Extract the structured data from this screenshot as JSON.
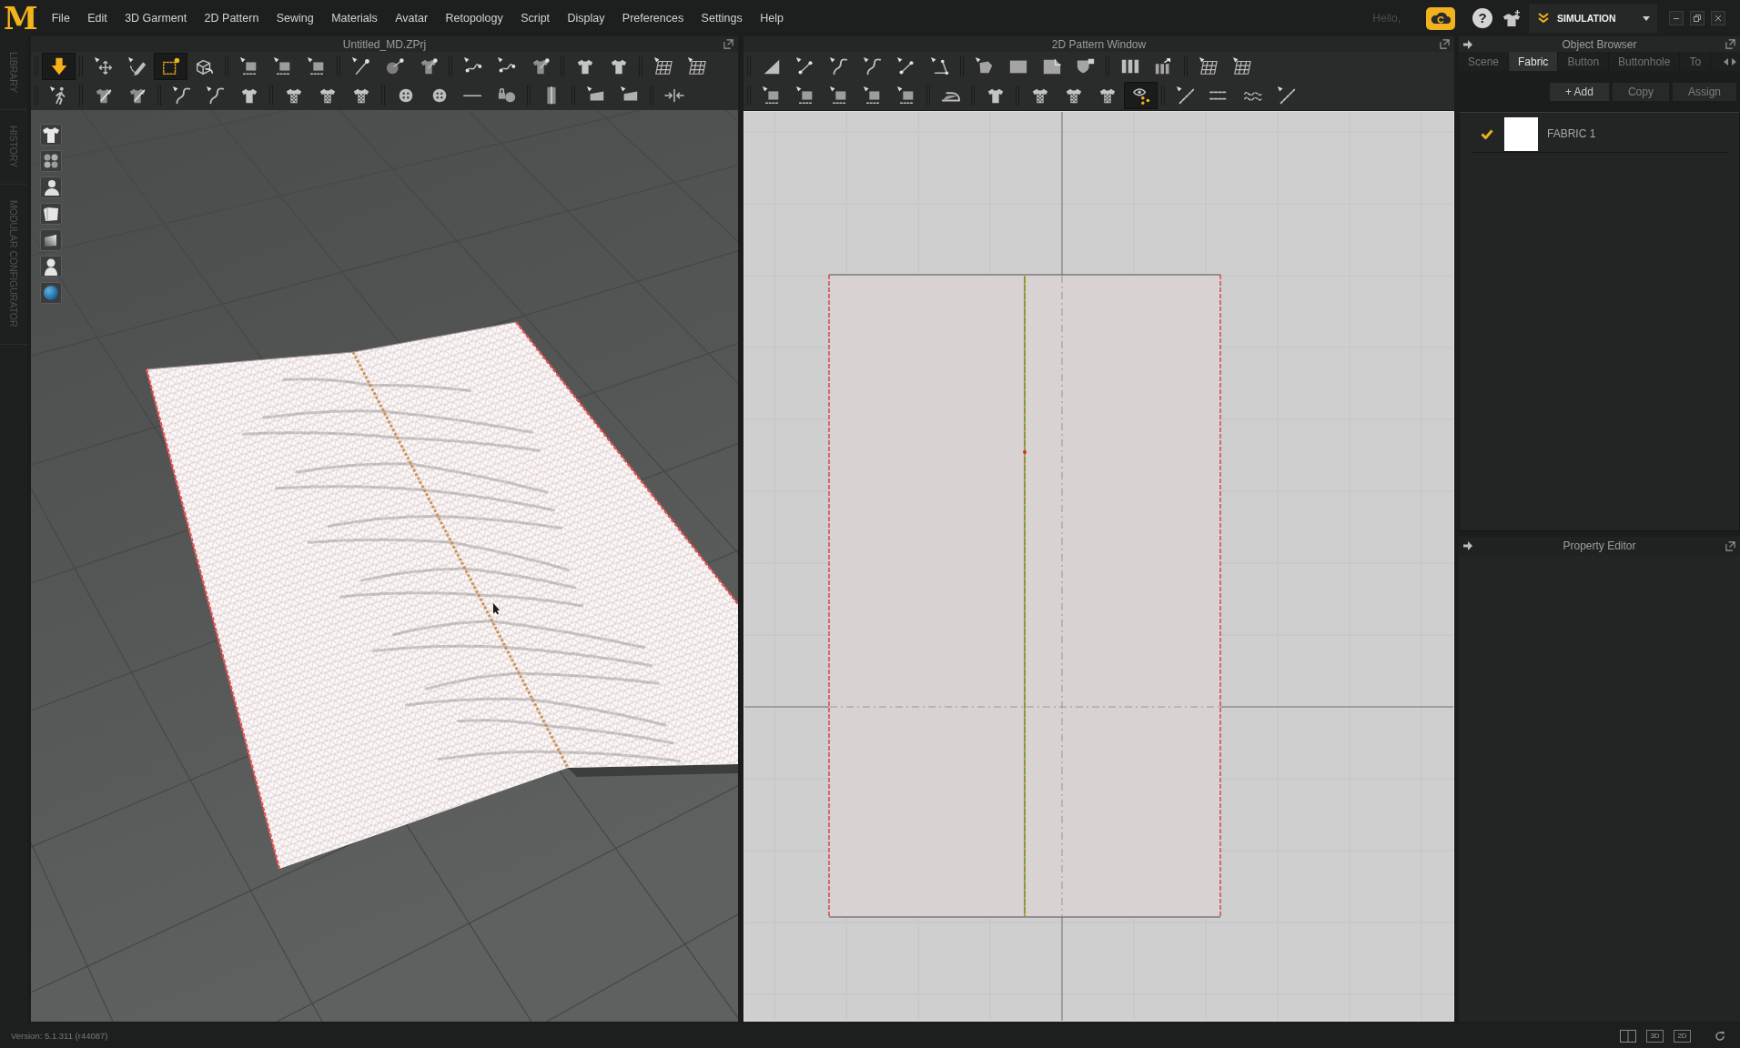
{
  "menu_bar": {
    "logo": "M",
    "menus": [
      "File",
      "Edit",
      "3D Garment",
      "2D Pattern",
      "Sewing",
      "Materials",
      "Avatar",
      "Retopology",
      "Script",
      "Display",
      "Preferences",
      "Settings",
      "Help"
    ],
    "greeting": "Hello,",
    "help": "?",
    "mode": "SIMULATION"
  },
  "side_tabs": [
    "LIBRARY",
    "HISTORY",
    "MODULAR CONFIGURATOR"
  ],
  "viewport_3d": {
    "title": "Untitled_MD.ZPrj",
    "toolbar_rows": [
      [
        [
          {
            "selected": true
          }
        ],
        [
          {
            "selected": false
          },
          {
            "selected": false
          },
          {
            "selected": true
          },
          {
            "selected": false
          }
        ],
        [
          {
            "selected": false
          },
          {
            "selected": false
          },
          {
            "selected": false
          }
        ],
        [
          {
            "selected": false
          },
          {
            "selected": false
          },
          {
            "selected": false
          }
        ],
        [
          {
            "selected": false
          },
          {
            "selected": false
          },
          {
            "selected": false
          }
        ],
        [
          {
            "selected": false
          },
          {
            "selected": false
          }
        ],
        [
          {
            "selected": false
          },
          {
            "selected": false
          }
        ]
      ],
      [
        [
          {
            "selected": false
          }
        ],
        [
          {
            "selected": false
          },
          {
            "selected": false
          }
        ],
        [
          {
            "selected": false
          },
          {
            "selected": false
          },
          {
            "selected": false
          }
        ],
        [
          {
            "selected": false
          },
          {
            "selected": false
          },
          {
            "selected": false
          }
        ],
        [
          {
            "selected": false
          },
          {
            "selected": false
          },
          {
            "selected": false
          },
          {
            "selected": false
          }
        ],
        [
          {
            "selected": false
          }
        ],
        [
          {
            "selected": false
          },
          {
            "selected": false
          }
        ],
        [
          {
            "selected": false
          }
        ]
      ]
    ]
  },
  "pattern_window": {
    "title": "2D Pattern Window",
    "toolbar_rows": [
      [
        [
          {
            "selected": false
          },
          {
            "selected": false
          },
          {
            "selected": false
          },
          {
            "selected": false
          },
          {
            "selected": false
          },
          {
            "selected": false
          }
        ],
        [
          {
            "selected": false
          },
          {
            "selected": false
          },
          {
            "selected": false
          },
          {
            "selected": false
          }
        ],
        [
          {
            "selected": false
          },
          {
            "selected": false
          }
        ],
        [
          {
            "selected": false
          },
          {
            "selected": false
          }
        ]
      ],
      [
        [
          {
            "selected": false
          },
          {
            "selected": false
          },
          {
            "selected": false
          },
          {
            "selected": false
          },
          {
            "selected": false
          }
        ],
        [
          {
            "selected": false
          }
        ],
        [
          {
            "selected": false
          }
        ],
        [
          {
            "selected": false
          },
          {
            "selected": false
          },
          {
            "selected": false
          },
          {
            "selected": true
          }
        ],
        [
          {
            "selected": false
          },
          {
            "selected": false
          },
          {
            "selected": false
          },
          {
            "selected": false
          }
        ]
      ]
    ]
  },
  "object_browser": {
    "title": "Object Browser",
    "tabs": [
      {
        "label": "Scene",
        "selected": false
      },
      {
        "label": "Fabric",
        "selected": true
      },
      {
        "label": "Button",
        "selected": false
      },
      {
        "label": "Buttonhole",
        "selected": false
      },
      {
        "label": "To",
        "selected": false
      }
    ],
    "actions": [
      {
        "label": "+ Add",
        "disabled": false
      },
      {
        "label": "Copy",
        "disabled": true
      },
      {
        "label": "Assign",
        "disabled": true
      }
    ],
    "fabrics": [
      {
        "name": "FABRIC 1",
        "checked": true,
        "color": "#ffffff"
      }
    ]
  },
  "property_editor": {
    "title": "Property Editor"
  },
  "status_bar": {
    "version": "Version: 5.1.311 (r44087)",
    "view_modes": [
      "3D",
      "2D"
    ]
  }
}
